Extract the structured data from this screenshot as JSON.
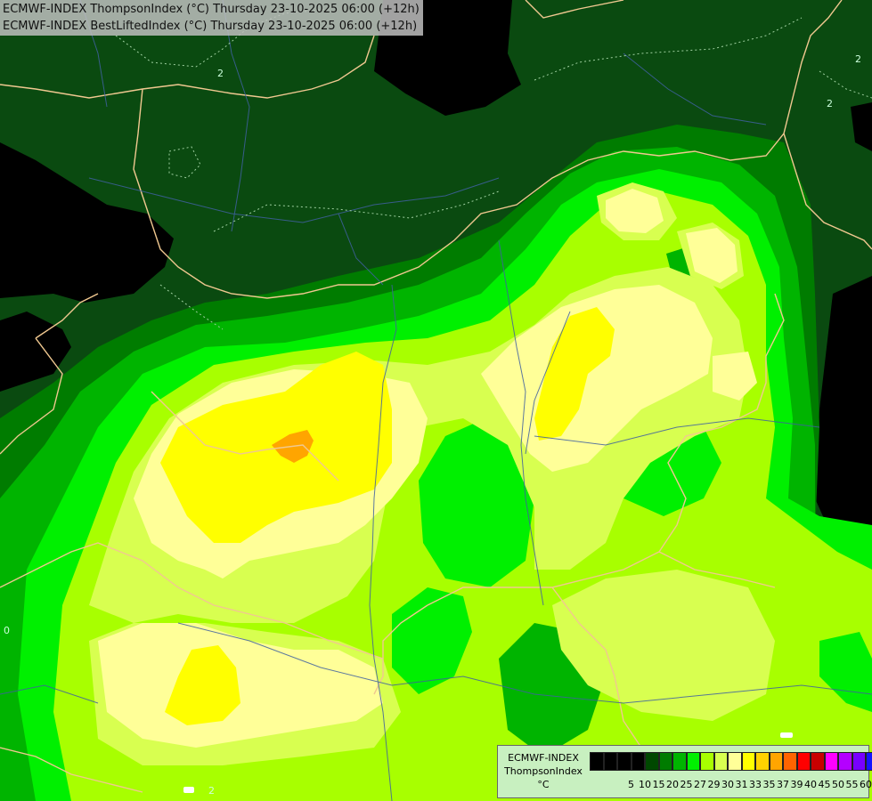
{
  "titles": [
    "ECMWF-INDEX ThompsonIndex (°C) Thursday 23-10-2025 06:00 (+12h)",
    "ECMWF-INDEX BestLiftedIndex (°C) Thursday 23-10-2025 06:00 (+12h)"
  ],
  "legend": {
    "model": "ECMWF-INDEX",
    "parameter": "ThompsonIndex",
    "unit": "°C",
    "levels": [
      "5",
      "10",
      "15",
      "20",
      "25",
      "27",
      "29",
      "30",
      "31",
      "33",
      "35",
      "37",
      "39",
      "40",
      "45",
      "50",
      "55",
      "60"
    ],
    "colors": [
      "#000000",
      "#000000",
      "#000000",
      "#000000",
      "#004800",
      "#007c00",
      "#00b400",
      "#00f000",
      "#a8ff00",
      "#d8ff50",
      "#ffff98",
      "#ffff00",
      "#ffd200",
      "#ffa500",
      "#ff6400",
      "#ff0000",
      "#c80000",
      "#ff00ff",
      "#b400ff",
      "#7800ff",
      "#1414ff"
    ]
  },
  "contour_labels": [
    "2",
    "2",
    "2",
    "0",
    "2"
  ]
}
